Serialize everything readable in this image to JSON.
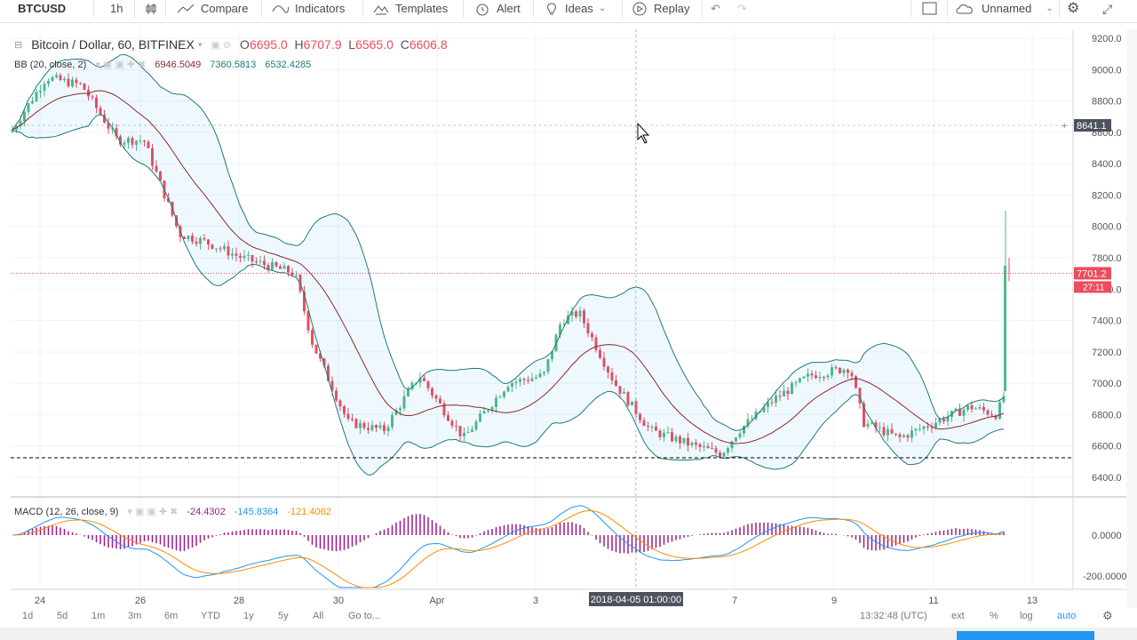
{
  "toolbar": {
    "symbol": "BTCUSD",
    "interval": "1h",
    "compare": "Compare",
    "indicators": "Indicators",
    "templates": "Templates",
    "alert": "Alert",
    "ideas": "Ideas",
    "replay": "Replay",
    "layout_name": "Unnamed"
  },
  "legend": {
    "title": "Bitcoin / Dollar, 60, BITFINEX",
    "open_label": "O",
    "open": "6695.0",
    "high_label": "H",
    "high": "6707.9",
    "low_label": "L",
    "low": "6565.0",
    "close_label": "C",
    "close": "6606.8",
    "bb_label": "BB (20, close, 2)",
    "bb_mid": "6946.5049",
    "bb_upper": "7360.5813",
    "bb_lower": "6532.4285",
    "macd_label": "MACD (12, 26, close, 9)",
    "macd_hist": "-24.4302",
    "macd_line": "-145.8364",
    "macd_signal": "-121.4062"
  },
  "price_axis": {
    "labels": [
      "9200.0",
      "9000.0",
      "8800.0",
      "8600.0",
      "8400.0",
      "8200.0",
      "8000.0",
      "7800.0",
      "7600.0",
      "7400.0",
      "7200.0",
      "7000.0",
      "6800.0",
      "6600.0",
      "6400.0"
    ],
    "crosshair": "8641.1",
    "last_price": "7701.2",
    "countdown": "27:11"
  },
  "macd_axis": {
    "labels": [
      "0.0000",
      "-200.0000"
    ]
  },
  "time_axis": {
    "labels": [
      "24",
      "26",
      "28",
      "30",
      "Apr",
      "3",
      "7",
      "9",
      "11",
      "13"
    ],
    "cursor_time": "2018-04-05 01:00:00"
  },
  "bottombar": {
    "ranges": [
      "1d",
      "5d",
      "1m",
      "3m",
      "6m",
      "YTD",
      "1y",
      "5y",
      "All"
    ],
    "goto": "Go to...",
    "clock": "13:32:48 (UTC)",
    "ext": "ext",
    "pct": "%",
    "log": "log",
    "auto": "auto"
  },
  "colors": {
    "up": "#53b987",
    "down": "#eb4d5c",
    "bb_band": "#1e7b75",
    "bb_basis": "#8a2a2a",
    "macd": "#2196f3",
    "signal": "#ff8c00",
    "hist": "#9c1a87",
    "accent": "#2196f3"
  }
}
